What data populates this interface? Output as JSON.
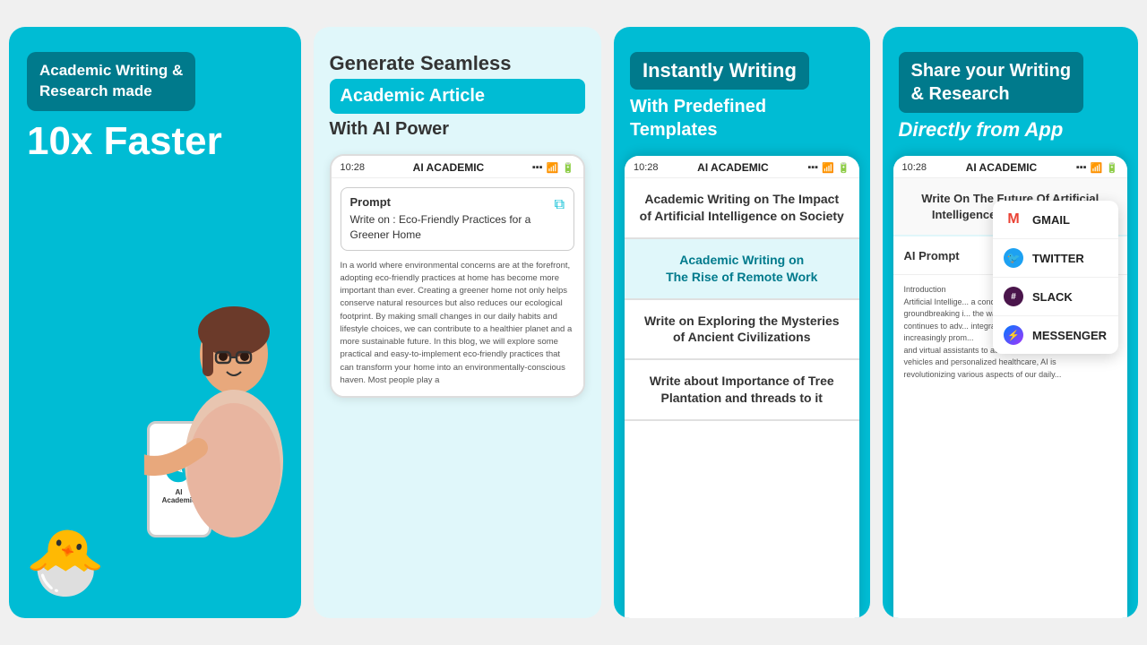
{
  "panel1": {
    "badge_text": "Academic Writing &\nResearch made",
    "big_text": "10x Faster",
    "app_label": "AI\nAcademic"
  },
  "panel2": {
    "title_line1": "Generate Seamless",
    "badge_text": "Academic Article",
    "title_line2": "With AI Power",
    "status_time": "10:28",
    "app_name": "AI ACADEMIC",
    "prompt_label": "Prompt",
    "prompt_text": "Write on : Eco-Friendly Practices for a Greener Home",
    "article_text": "In a world where environmental concerns are at the forefront, adopting eco-friendly practices at home has become more important than ever. Creating a greener home not only helps conserve natural resources but also reduces our ecological footprint. By making small changes in our daily habits and lifestyle choices, we can contribute to a healthier planet and a more sustainable future. In this blog, we will explore some practical and easy-to-implement eco-friendly practices that can transform your home into an environmentally-conscious haven. Most people play a"
  },
  "panel3": {
    "badge_text": "Instantly Writing",
    "subtitle": "With Predefined\nTemplates",
    "status_time": "10:28",
    "app_name": "AI ACADEMIC",
    "items": [
      "Academic Writing on The Impact of Artificial Intelligence on Society",
      "Academic Writing on\nThe Rise of Remote Work",
      "Write on Exploring the Mysteries\nof Ancient Civilizations",
      "Write about Importance of Tree\nPlantation and threads to it"
    ]
  },
  "panel4": {
    "badge_text": "Share your Writing\n& Research",
    "subtitle": "Directly from App",
    "status_time": "10:28",
    "app_name": "AI ACADEMIC",
    "write_topic": "Write On The Future Of Artificial Intelligence In Everyday Life",
    "ai_prompt_label": "AI Prompt",
    "article_text": "Introduction\nArtificial Intellige... a concept of scie... groundbreaking i... the way we live, ... continues to adv... integration into o... increasingly prom... and virtual assistants to autonomous vehicles and personalized healthcare, AI is revolutionizing various aspects of our daily...",
    "share_items": [
      {
        "name": "GMAIL",
        "icon_type": "gmail"
      },
      {
        "name": "TWITTER",
        "icon_type": "twitter"
      },
      {
        "name": "SLACK",
        "icon_type": "slack"
      },
      {
        "name": "MESSENGER",
        "icon_type": "messenger"
      }
    ]
  }
}
